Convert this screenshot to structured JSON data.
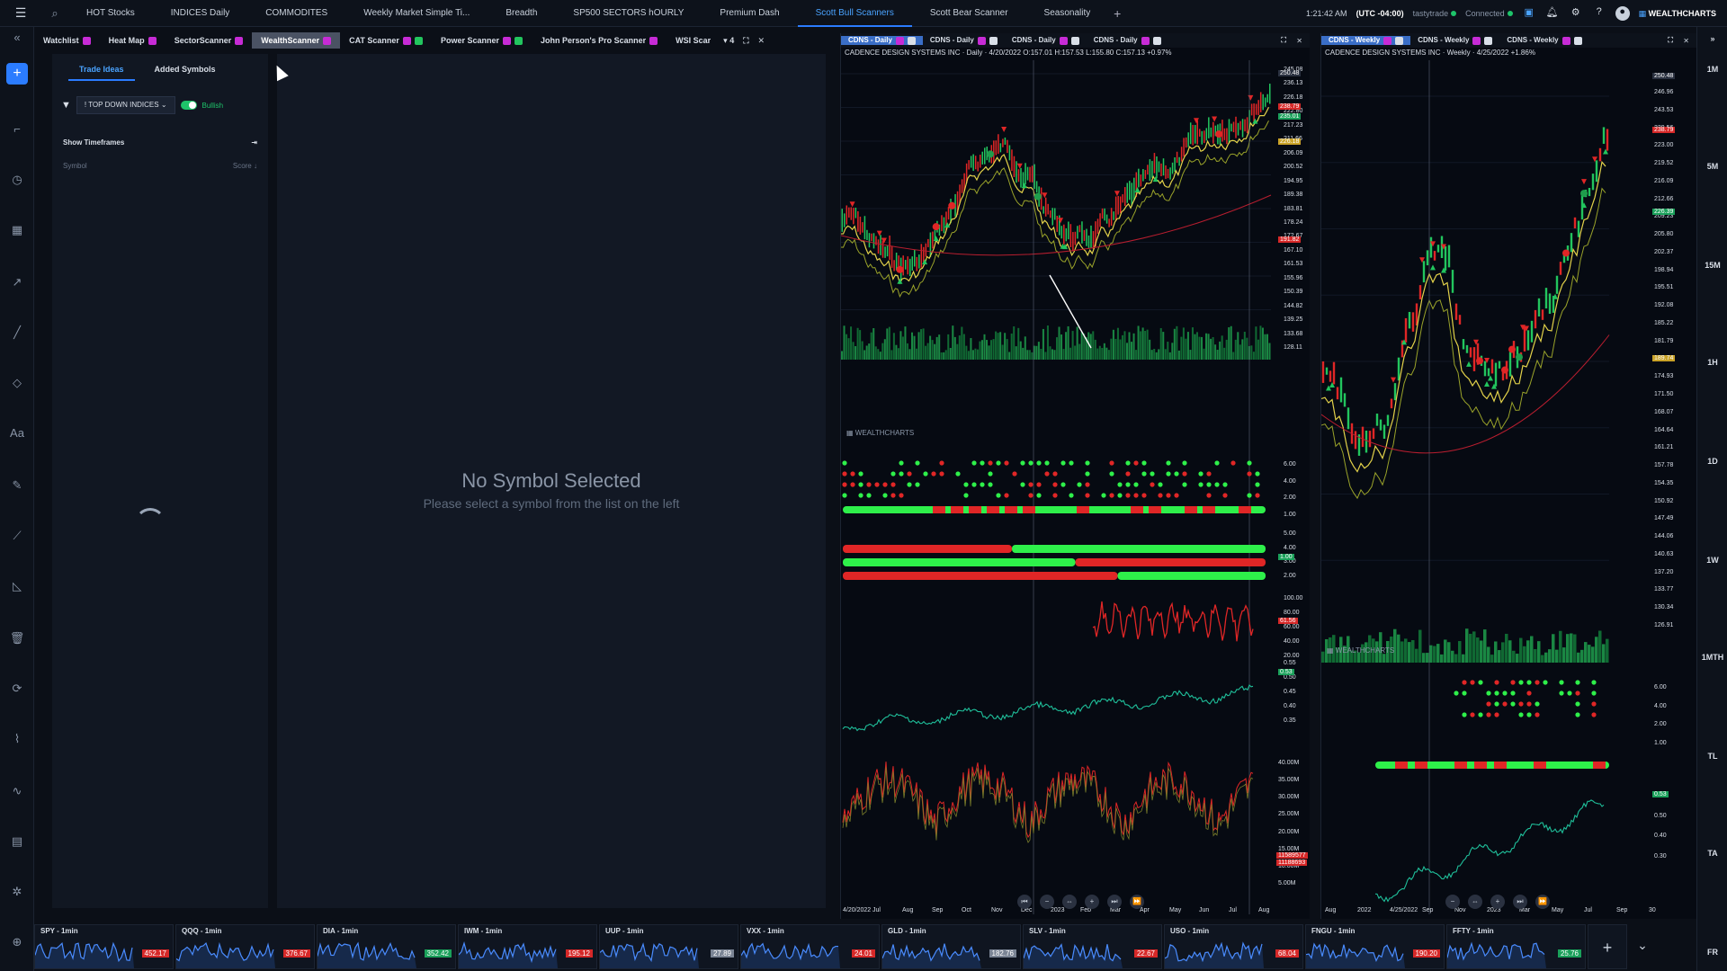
{
  "topbar": {
    "tabs": [
      "HOT Stocks",
      "INDICES Daily",
      "COMMODITES",
      "Weekly Market Simple Ti...",
      "Breadth",
      "SP500 SECTORS hOURLY",
      "Premium Dash",
      "Scott Bull Scanners",
      "Scott Bear Scanner",
      "Seasonality"
    ],
    "active_tab": "Scott Bull Scanners",
    "time": "1:21:42 AM",
    "timezone": "(UTC -04:00)",
    "broker": "tastytrade",
    "status": "Connected",
    "brand": "WEALTHCHARTS"
  },
  "subtabs": [
    {
      "label": "Watchlist",
      "badge": "bm"
    },
    {
      "label": "Heat Map",
      "badge": "bm"
    },
    {
      "label": "SectorScanner",
      "badge": "bm"
    },
    {
      "label": "WealthScanner",
      "badge": "bm",
      "active": true
    },
    {
      "label": "CAT Scanner",
      "badge": "bm",
      "badge2": "bg"
    },
    {
      "label": "Power Scanner",
      "badge": "bm",
      "badge2": "bg"
    },
    {
      "label": "John Person's Pro Scanner",
      "badge": "bm"
    },
    {
      "label": "WSI Scar",
      "badge": ""
    }
  ],
  "subtabs_more": "▾ 4",
  "panel": {
    "tab_trade_ideas": "Trade Ideas",
    "tab_added_symbols": "Added Symbols",
    "filter_select": "! TOP DOWN INDICES",
    "toggle_label": "Bullish",
    "show_timeframes": "Show Timeframes",
    "col_symbol": "Symbol",
    "col_score": "Score"
  },
  "content": {
    "empty_title": "No Symbol Selected",
    "empty_subtitle": "Please select a symbol from the list on the left"
  },
  "chart_left": {
    "tabs": [
      "CDNS - Daily",
      "CDNS - Daily",
      "CDNS - Daily",
      "CDNS - Daily"
    ],
    "info": "CADENCE DESIGN SYSTEMS INC · Daily · 4/20/2022  O:157.01 H:157.53 L:155.80 C:157.13 +0.97%",
    "price_axis": [
      "245.08",
      "236.13",
      "226.18",
      "222.80",
      "217.23",
      "211.66",
      "206.09",
      "200.52",
      "194.95",
      "189.38",
      "183.81",
      "178.24",
      "172.67",
      "167.10",
      "161.53",
      "155.96",
      "150.39",
      "144.82",
      "139.25",
      "133.68",
      "128.11"
    ],
    "price_labels": [
      {
        "v": "250.48",
        "c": "#2a3140"
      },
      {
        "v": "238.79",
        "c": "#d62828"
      },
      {
        "v": "235.01",
        "c": "#1aa05a"
      },
      {
        "v": "226.18",
        "c": "#c9a227"
      },
      {
        "v": "191.82",
        "c": "#d62828"
      }
    ],
    "osc1_axis": [
      "6.00",
      "4.00",
      "2.00",
      "1.00"
    ],
    "osc2_axis": [
      "5.00",
      "4.00",
      "3.00",
      "2.00"
    ],
    "osc2_label": "1.00",
    "rsi_axis": [
      "100.00",
      "80.00",
      "60.00",
      "40.00",
      "20.00"
    ],
    "rsi_label": "61.56",
    "cmf_axis": [
      "0.55",
      "0.50",
      "0.45",
      "0.40",
      "0.35"
    ],
    "cmf_label": "0.53",
    "vol_axis": [
      "40.00M",
      "35.00M",
      "30.00M",
      "25.00M",
      "20.00M",
      "15.00M",
      "10.00M",
      "5.00M"
    ],
    "vol_labels": [
      "11589577",
      "11188693"
    ],
    "date_axis": [
      "4/20/2022",
      "Jul",
      "Aug",
      "Sep",
      "Oct",
      "Nov",
      "Dec",
      "2023",
      "Feb",
      "Mar",
      "Apr",
      "May",
      "Jun",
      "Jul",
      "Aug"
    ],
    "brand": "WEALTHCHARTS"
  },
  "chart_right": {
    "tabs": [
      "CDNS - Weekly",
      "CDNS - Weekly",
      "CDNS - Weekly"
    ],
    "info": "CADENCE DESIGN SYSTEMS INC · Weekly · 4/25/2022  +1.86%",
    "price_axis": [
      "246.96",
      "243.53",
      "229.56",
      "223.00",
      "219.52",
      "216.09",
      "212.66",
      "209.23",
      "205.80",
      "202.37",
      "198.94",
      "195.51",
      "192.08",
      "185.22",
      "181.79",
      "178.36",
      "174.93",
      "171.50",
      "168.07",
      "164.64",
      "161.21",
      "157.78",
      "154.35",
      "150.92",
      "147.49",
      "144.06",
      "140.63",
      "137.20",
      "133.77",
      "130.34",
      "126.91"
    ],
    "price_labels": [
      {
        "v": "250.48",
        "c": "#2a3140"
      },
      {
        "v": "238.79",
        "c": "#d62828"
      },
      {
        "v": "226.39",
        "c": "#1aa05a"
      },
      {
        "v": "189.74",
        "c": "#c9a227"
      }
    ],
    "osc1_axis": [
      "6.00",
      "4.00",
      "2.00",
      "1.00"
    ],
    "cmf_axis": [
      "0.60",
      "0.50",
      "0.40",
      "0.30"
    ],
    "cmf_label": "0.53",
    "date_axis": [
      "Aug",
      "2022",
      "4/25/2022",
      "Sep",
      "Nov",
      "2023",
      "Mar",
      "May",
      "Jul",
      "Sep",
      "30"
    ],
    "brand": "WEALTHCHARTS"
  },
  "rightbar": [
    "1M",
    "5M",
    "15M",
    "1H",
    "1D",
    "1W",
    "1MTH",
    "TL",
    "TA",
    "FR"
  ],
  "tickers": [
    {
      "name": "SPY - 1min",
      "price": "452.17",
      "color": "#d62828"
    },
    {
      "name": "QQQ - 1min",
      "price": "376.67",
      "color": "#d62828"
    },
    {
      "name": "DIA - 1min",
      "price": "352.42",
      "color": "#1aa05a"
    },
    {
      "name": "IWM - 1min",
      "price": "195.12",
      "color": "#d62828"
    },
    {
      "name": "UUP - 1min",
      "price": "27.89",
      "color": "#7a8494"
    },
    {
      "name": "VXX - 1min",
      "price": "24.01",
      "color": "#d62828"
    },
    {
      "name": "GLD - 1min",
      "price": "182.76",
      "color": "#7a8494"
    },
    {
      "name": "SLV - 1min",
      "price": "22.67",
      "color": "#d62828"
    },
    {
      "name": "USO - 1min",
      "price": "68.04",
      "color": "#d62828"
    },
    {
      "name": "FNGU - 1min",
      "price": "190.20",
      "color": "#d62828"
    },
    {
      "name": "FFTY - 1min",
      "price": "25.76",
      "color": "#1aa05a"
    }
  ]
}
